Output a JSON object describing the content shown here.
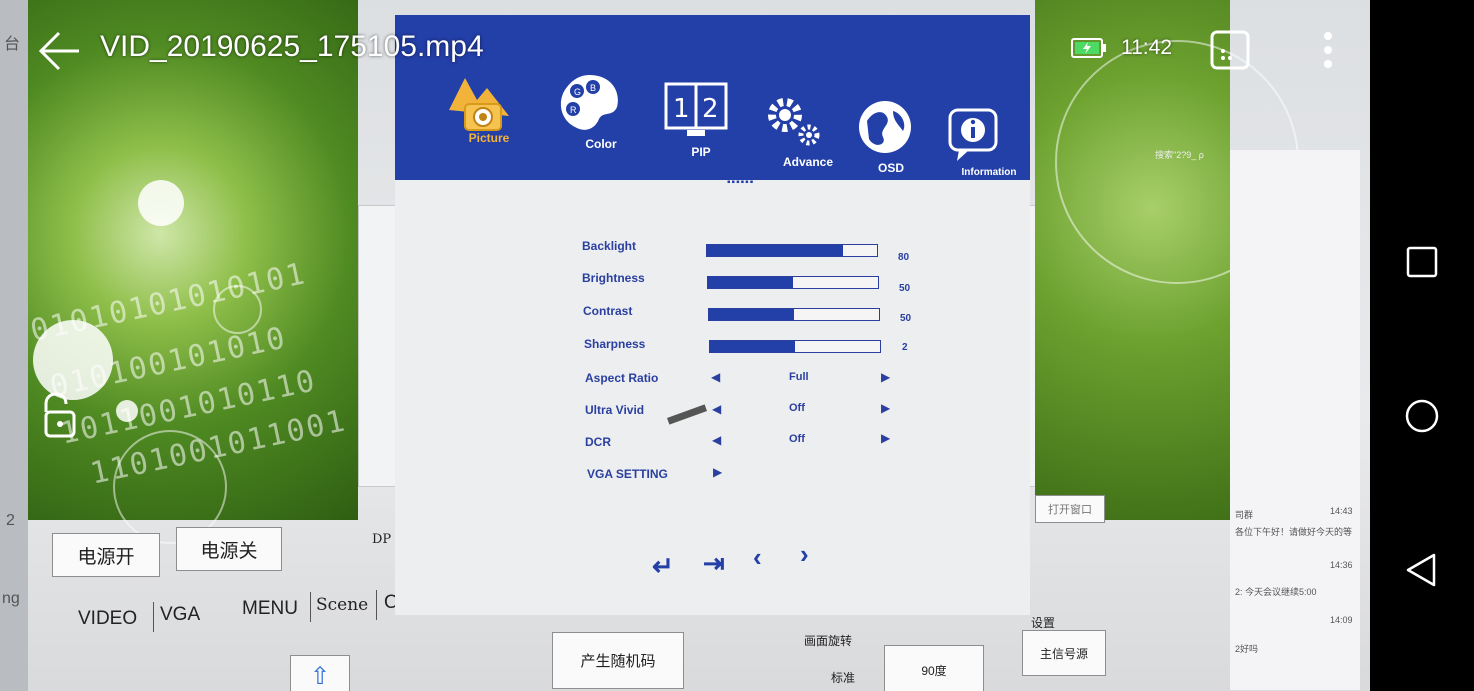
{
  "video_player": {
    "title": "VID_20190625_175105.mp4",
    "time": "11:42",
    "icons": [
      "back-arrow-icon",
      "battery-charging-icon",
      "cast-icon",
      "more-vert-icon",
      "unlock-icon"
    ]
  },
  "osd": {
    "tabs": [
      {
        "label": "Picture",
        "icon": "picture-icon"
      },
      {
        "label": "Color",
        "icon": "color-palette-icon"
      },
      {
        "label": "PIP",
        "icon": "pip-icon"
      },
      {
        "label": "Advance",
        "icon": "gear-icon"
      },
      {
        "label": "OSD",
        "icon": "globe-icon"
      },
      {
        "label": "Information",
        "icon": "info-icon"
      }
    ],
    "page_dots": "▪▪▪▪▪▪",
    "sliders": [
      {
        "label": "Backlight",
        "value": "80",
        "fraction": 0.8
      },
      {
        "label": "Brightness",
        "value": "50",
        "fraction": 0.5
      },
      {
        "label": "Contrast",
        "value": "50",
        "fraction": 0.5
      },
      {
        "label": "Sharpness",
        "value": "2",
        "fraction": 0.5
      }
    ],
    "options": [
      {
        "label": "Aspect Ratio",
        "value": "Full"
      },
      {
        "label": "Ultra Vivid",
        "value": "Off"
      },
      {
        "label": "DCR",
        "value": "Off"
      }
    ],
    "vga_setting": "VGA SETTING",
    "nav_controls": [
      "enter-icon",
      "exit-icon",
      "left-icon",
      "right-icon"
    ]
  },
  "control_app": {
    "power_on": "电源开",
    "power_off": "电源关",
    "dp": "DP",
    "video": "VIDEO",
    "vga": "VGA",
    "menu": "MENU",
    "scene": "Scene",
    "o": "O",
    "random_code": "产生随机码",
    "rotate_label": "画面旋转",
    "rotate_standard": "标准",
    "rotate_90": "90度",
    "settings_label": "设置",
    "main_source": "主信号源",
    "open_port": "打开窗口",
    "up_arrow": "⇧"
  },
  "background": {
    "left_edge_char": "台",
    "left_edge_num": "2",
    "left_edge_text": "ng",
    "search_hint": "搜索\"2?9_ ρ",
    "chat_group": "司群",
    "chat_line1": "各位下午好！请做好今天的等",
    "chat_time1": "14:43",
    "chat_time2": "14:36",
    "chat_line2": "2: 今天会议继续5:00",
    "chat_time3": "14:09",
    "chat_line3": "2好吗"
  },
  "colors": {
    "osd_blue": "#233fa8",
    "osd_bg": "#eceef0",
    "battery_green": "#4cd964"
  }
}
